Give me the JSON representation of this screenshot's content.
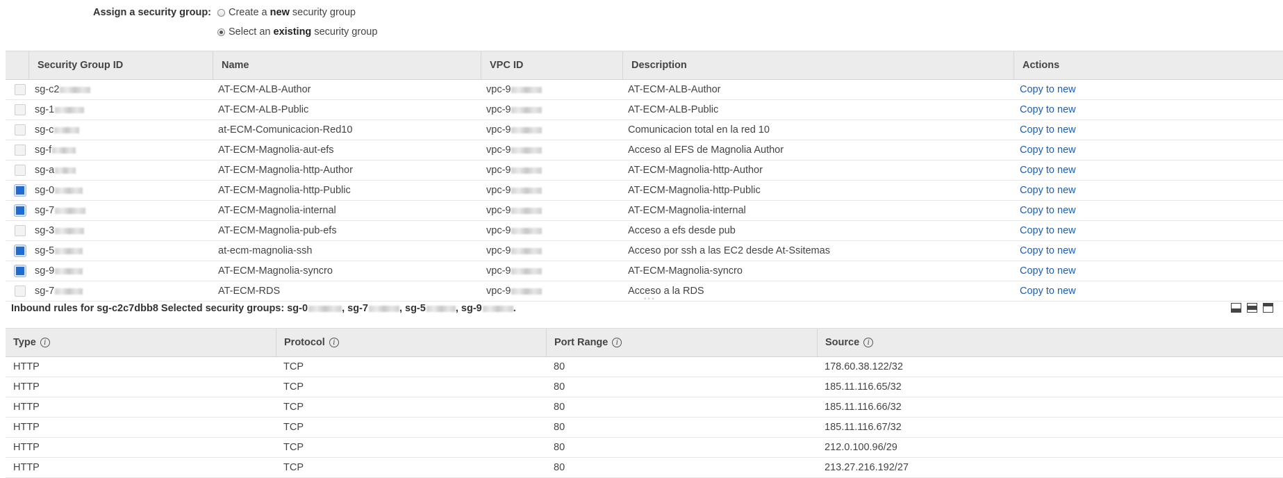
{
  "assign": {
    "label": "Assign a security group:",
    "options": [
      {
        "pre": "Create a ",
        "bold": "new",
        "post": " security group",
        "checked": false
      },
      {
        "pre": "Select an ",
        "bold": "existing",
        "post": " security group",
        "checked": true
      }
    ]
  },
  "sg_table": {
    "headers": {
      "id": "Security Group ID",
      "name": "Name",
      "vpc": "VPC ID",
      "description": "Description",
      "actions": "Actions"
    },
    "rows": [
      {
        "id": "sg-c2",
        "name": "AT-ECM-ALB-Author",
        "vpc": "vpc-9",
        "description": "AT-ECM-ALB-Author",
        "action": "Copy to new",
        "checked": false
      },
      {
        "id": "sg-1",
        "name": "AT-ECM-ALB-Public",
        "vpc": "vpc-9",
        "description": "AT-ECM-ALB-Public",
        "action": "Copy to new",
        "checked": false
      },
      {
        "id": "sg-c",
        "name": "at-ECM-Comunicacion-Red10",
        "vpc": "vpc-9",
        "description": "Comunicacion total en la red 10",
        "action": "Copy to new",
        "checked": false
      },
      {
        "id": "sg-f",
        "name": "AT-ECM-Magnolia-aut-efs",
        "vpc": "vpc-9",
        "description": "Acceso al EFS de Magnolia Author",
        "action": "Copy to new",
        "checked": false
      },
      {
        "id": "sg-a",
        "name": "AT-ECM-Magnolia-http-Author",
        "vpc": "vpc-9",
        "description": "AT-ECM-Magnolia-http-Author",
        "action": "Copy to new",
        "checked": false
      },
      {
        "id": "sg-0",
        "name": "AT-ECM-Magnolia-http-Public",
        "vpc": "vpc-9",
        "description": "AT-ECM-Magnolia-http-Public",
        "action": "Copy to new",
        "checked": true
      },
      {
        "id": "sg-7",
        "name": "AT-ECM-Magnolia-internal",
        "vpc": "vpc-9",
        "description": "AT-ECM-Magnolia-internal",
        "action": "Copy to new",
        "checked": true
      },
      {
        "id": "sg-3",
        "name": "AT-ECM-Magnolia-pub-efs",
        "vpc": "vpc-9",
        "description": "Acceso a efs desde pub",
        "action": "Copy to new",
        "checked": false
      },
      {
        "id": "sg-5",
        "name": "at-ecm-magnolia-ssh",
        "vpc": "vpc-9",
        "description": "Acceso por ssh a las EC2 desde At-Ssitemas",
        "action": "Copy to new",
        "checked": true
      },
      {
        "id": "sg-9",
        "name": "AT-ECM-Magnolia-syncro",
        "vpc": "vpc-9",
        "description": "AT-ECM-Magnolia-syncro",
        "action": "Copy to new",
        "checked": true
      },
      {
        "id": "sg-7",
        "name": "AT-ECM-RDS",
        "vpc": "vpc-9",
        "description": "Acceso a la RDS",
        "action": "Copy to new",
        "checked": false
      }
    ]
  },
  "splitter": "◦◦◦",
  "inbound": {
    "prefix": "Inbound rules for sg-c2c7dbb8 Selected security groups: ",
    "groups": [
      "sg-0",
      "sg-7",
      "sg-5",
      "sg-9"
    ],
    "headers": {
      "type": "Type",
      "protocol": "Protocol",
      "port": "Port Range",
      "source": "Source"
    },
    "info_glyph": "i",
    "rows": [
      {
        "type": "HTTP",
        "protocol": "TCP",
        "port": "80",
        "source": "178.60.38.122/32"
      },
      {
        "type": "HTTP",
        "protocol": "TCP",
        "port": "80",
        "source": "185.11.116.65/32"
      },
      {
        "type": "HTTP",
        "protocol": "TCP",
        "port": "80",
        "source": "185.11.116.66/32"
      },
      {
        "type": "HTTP",
        "protocol": "TCP",
        "port": "80",
        "source": "185.11.116.67/32"
      },
      {
        "type": "HTTP",
        "protocol": "TCP",
        "port": "80",
        "source": "212.0.100.96/29"
      },
      {
        "type": "HTTP",
        "protocol": "TCP",
        "port": "80",
        "source": "213.27.216.192/27"
      }
    ]
  },
  "icons": {
    "layout_buttons": [
      "layout-bottom-icon",
      "layout-split-icon",
      "layout-top-icon"
    ]
  }
}
